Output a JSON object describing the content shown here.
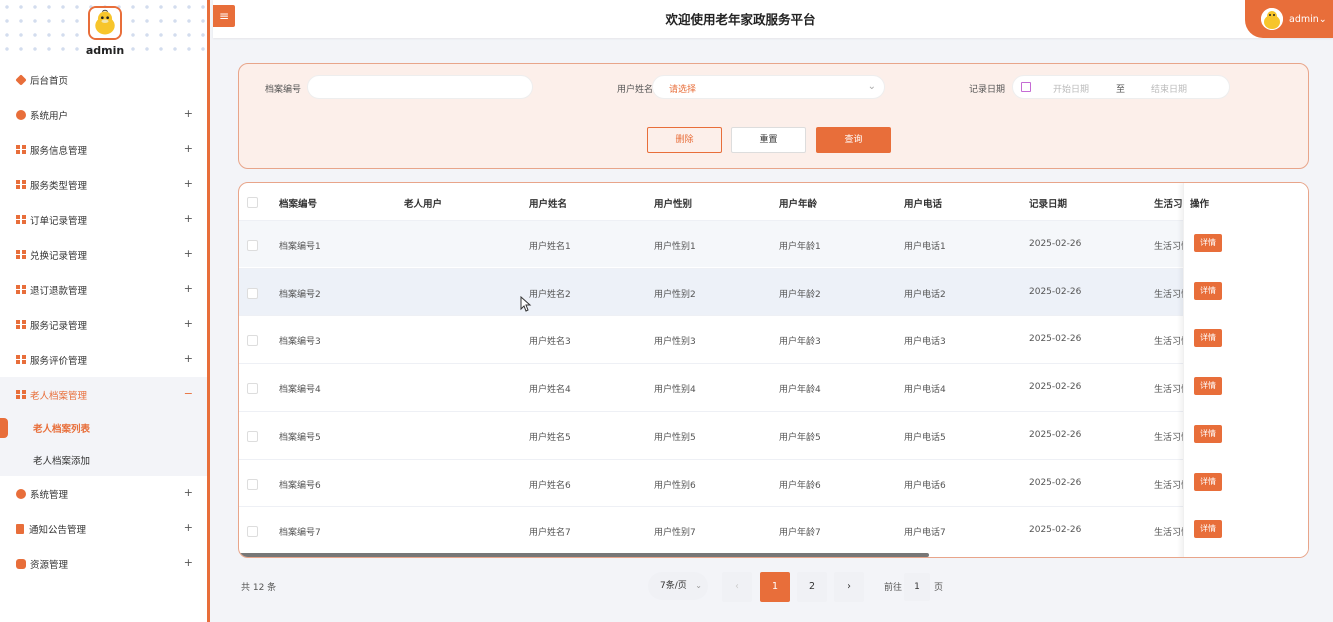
{
  "sidebar": {
    "admin_name": "admin",
    "menu": [
      {
        "label": "后台首页",
        "icon": "home-icon",
        "expandable": false
      },
      {
        "label": "系统用户",
        "icon": "user-icon",
        "expandable": true
      },
      {
        "label": "服务信息管理",
        "icon": "grid-icon",
        "expandable": true
      },
      {
        "label": "服务类型管理",
        "icon": "grid-icon",
        "expandable": true
      },
      {
        "label": "订单记录管理",
        "icon": "grid-icon",
        "expandable": true
      },
      {
        "label": "兑换记录管理",
        "icon": "grid-icon",
        "expandable": true
      },
      {
        "label": "退订退款管理",
        "icon": "grid-icon",
        "expandable": true
      },
      {
        "label": "服务记录管理",
        "icon": "grid-icon",
        "expandable": true
      },
      {
        "label": "服务评价管理",
        "icon": "grid-icon",
        "expandable": true
      },
      {
        "label": "老人档案管理",
        "icon": "grid-icon",
        "expandable": true,
        "open": true
      }
    ],
    "submenu": [
      {
        "label": "老人档案列表",
        "active": true
      },
      {
        "label": "老人档案添加",
        "active": false
      }
    ],
    "menu_after": [
      {
        "label": "系统管理",
        "icon": "gear-icon"
      },
      {
        "label": "通知公告管理",
        "icon": "notice-icon"
      },
      {
        "label": "资源管理",
        "icon": "database-icon"
      }
    ],
    "plus": "+",
    "minus": "−"
  },
  "header": {
    "title": "欢迎使用老年家政服务平台",
    "toggle_icon": "≡",
    "user_name": "admin",
    "caret": "⌄"
  },
  "search": {
    "archive_no_label": "档案编号",
    "archive_no_value": "",
    "user_name_label": "用户姓名",
    "user_name_placeholder": "请选择",
    "record_date_label": "记录日期",
    "date_start_placeholder": "开始日期",
    "date_separator": "至",
    "date_end_placeholder": "结束日期",
    "delete_label": "删除",
    "reset_label": "重置",
    "query_label": "查询"
  },
  "table": {
    "headers": [
      "档案编号",
      "老人用户",
      "用户姓名",
      "用户性别",
      "用户年龄",
      "用户电话",
      "记录日期",
      "生活习",
      "操作"
    ],
    "rows": [
      [
        "档案编号1",
        "",
        "用户姓名1",
        "用户性别1",
        "用户年龄1",
        "用户电话1",
        "2025-02-26",
        "生活习惯"
      ],
      [
        "档案编号2",
        "",
        "用户姓名2",
        "用户性别2",
        "用户年龄2",
        "用户电话2",
        "2025-02-26",
        "生活习惯"
      ],
      [
        "档案编号3",
        "",
        "用户姓名3",
        "用户性别3",
        "用户年龄3",
        "用户电话3",
        "2025-02-26",
        "生活习惯"
      ],
      [
        "档案编号4",
        "",
        "用户姓名4",
        "用户性别4",
        "用户年龄4",
        "用户电话4",
        "2025-02-26",
        "生活习惯"
      ],
      [
        "档案编号5",
        "",
        "用户姓名5",
        "用户性别5",
        "用户年龄5",
        "用户电话5",
        "2025-02-26",
        "生活习惯"
      ],
      [
        "档案编号6",
        "",
        "用户姓名6",
        "用户性别6",
        "用户年龄6",
        "用户电话6",
        "2025-02-26",
        "生活习惯"
      ],
      [
        "档案编号7",
        "",
        "用户姓名7",
        "用户性别7",
        "用户年龄7",
        "用户电话7",
        "2025-02-26",
        "生活习惯"
      ]
    ],
    "detail_label": "详情"
  },
  "pagination": {
    "total": "共 12 条",
    "page_size": "7条/页",
    "prev": "‹",
    "next": "›",
    "pages": [
      "1",
      "2"
    ],
    "current": "1",
    "goto_label": "前往",
    "goto_value": "1",
    "goto_suffix": "页"
  },
  "colors": {
    "accent": "#e86e3a",
    "panel_bg": "#fcefea"
  }
}
